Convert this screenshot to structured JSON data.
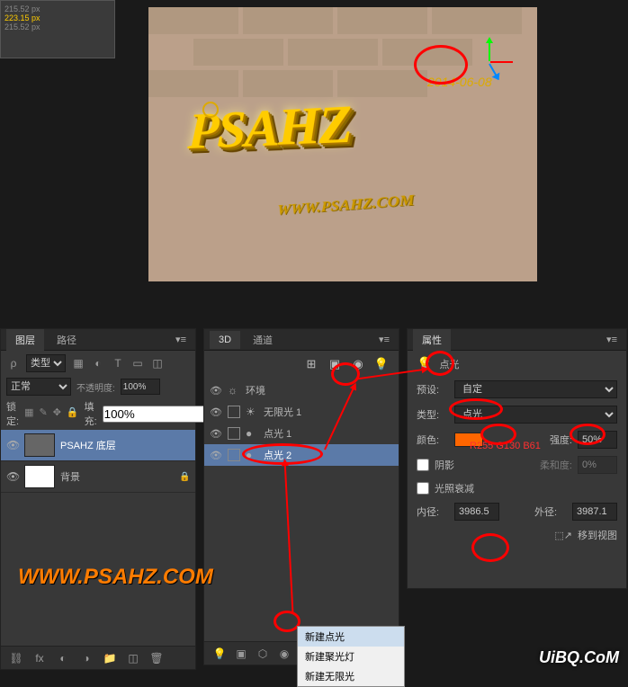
{
  "viewport": {
    "main_text": "PSAHZ",
    "url_text": "WWW.PSAHZ.COM",
    "date_text": "2014-06-08"
  },
  "topbar": {
    "line1": "215.52 px",
    "line2": "215.52 px",
    "note": "223.15 px"
  },
  "layers_panel": {
    "tabs": [
      "图层",
      "路径"
    ],
    "filter_label": "类型",
    "blend_mode": "正常",
    "opacity_label": "不透明度:",
    "opacity_value": "100%",
    "lock_label": "锁定:",
    "fill_label": "填充:",
    "fill_value": "100%",
    "layers": [
      {
        "name": "PSAHZ 底层",
        "bg": false
      },
      {
        "name": "背景",
        "bg": true
      }
    ]
  },
  "d3_panel": {
    "tabs": [
      "3D",
      "通道"
    ],
    "items": [
      {
        "label": "环境",
        "icon": "☼",
        "selected": false
      },
      {
        "label": "无限光 1",
        "icon": "☀",
        "selected": false
      },
      {
        "label": "点光 1",
        "icon": "●",
        "selected": false
      },
      {
        "label": "点光 2",
        "icon": "●",
        "selected": true
      }
    ]
  },
  "light_menu": {
    "items": [
      "新建点光",
      "新建聚光灯",
      "新建无限光"
    ]
  },
  "prop_panel": {
    "tab": "属性",
    "title": "点光",
    "preset_label": "预设:",
    "preset_value": "自定",
    "type_label": "类型:",
    "type_value": "点光",
    "color_label": "颜色:",
    "intensity_label": "强度:",
    "intensity_value": "50%",
    "color_note": "R255 G130 B61",
    "shadow_label": "阴影",
    "softness_label": "柔和度:",
    "softness_value": "0%",
    "falloff_label": "光照衰减",
    "inner_label": "内径:",
    "inner_value": "3986.5",
    "outer_label": "外径:",
    "outer_value": "3987.1",
    "move_view": "移到视图"
  },
  "watermark": "WWW.PSAHZ.COM",
  "watermark2": "UiBQ.CoM"
}
